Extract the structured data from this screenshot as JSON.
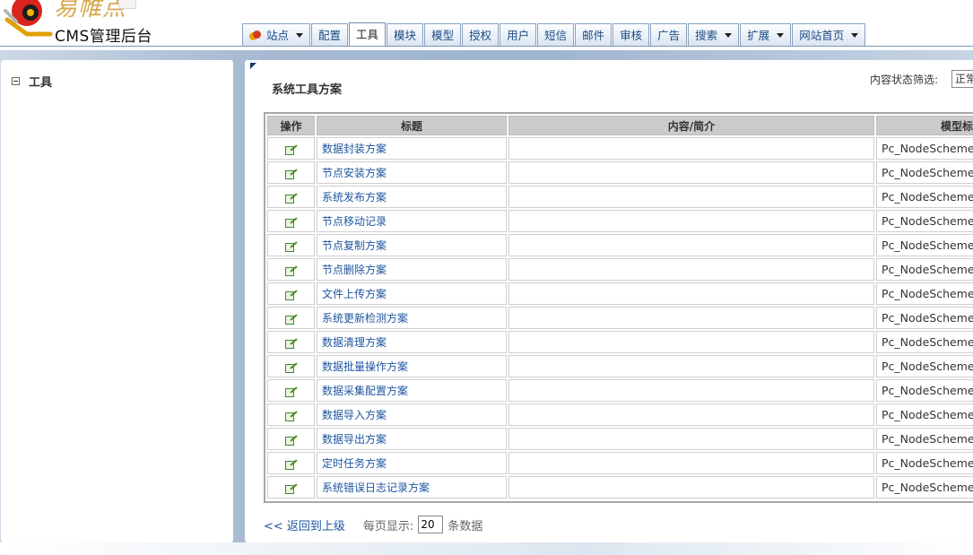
{
  "header": {
    "brand_top": "易帷点",
    "brand": "CMS管理后台"
  },
  "nav": {
    "items": [
      {
        "label": "站点",
        "dropdown": true,
        "icon": "site-icon"
      },
      {
        "label": "配置",
        "dropdown": false
      },
      {
        "label": "工具",
        "dropdown": false,
        "active": true
      },
      {
        "label": "模块",
        "dropdown": false
      },
      {
        "label": "模型",
        "dropdown": false
      },
      {
        "label": "授权",
        "dropdown": false
      },
      {
        "label": "用户",
        "dropdown": false
      },
      {
        "label": "短信",
        "dropdown": false
      },
      {
        "label": "邮件",
        "dropdown": false
      },
      {
        "label": "审核",
        "dropdown": false
      },
      {
        "label": "广告",
        "dropdown": false
      },
      {
        "label": "搜索",
        "dropdown": true
      },
      {
        "label": "扩展",
        "dropdown": true
      },
      {
        "label": "网站首页",
        "dropdown": true
      }
    ]
  },
  "sidebar": {
    "root_label": "工具"
  },
  "main": {
    "title": "系统工具方案",
    "filter_label": "内容状态筛选:",
    "filter_value": "正常",
    "columns": [
      "操作",
      "标题",
      "内容/简介",
      "模型标"
    ],
    "rows": [
      {
        "title": "数据封装方案",
        "summary": "",
        "model": "Pc_NodeScheme"
      },
      {
        "title": "节点安装方案",
        "summary": "",
        "model": "Pc_NodeScheme"
      },
      {
        "title": "系统发布方案",
        "summary": "",
        "model": "Pc_NodeScheme"
      },
      {
        "title": "节点移动记录",
        "summary": "",
        "model": "Pc_NodeScheme"
      },
      {
        "title": "节点复制方案",
        "summary": "",
        "model": "Pc_NodeScheme"
      },
      {
        "title": "节点删除方案",
        "summary": "",
        "model": "Pc_NodeScheme"
      },
      {
        "title": "文件上传方案",
        "summary": "",
        "model": "Pc_NodeScheme"
      },
      {
        "title": "系统更新检测方案",
        "summary": "",
        "model": "Pc_NodeScheme"
      },
      {
        "title": "数据清理方案",
        "summary": "",
        "model": "Pc_NodeScheme"
      },
      {
        "title": "数据批量操作方案",
        "summary": "",
        "model": "Pc_NodeScheme"
      },
      {
        "title": "数据采集配置方案",
        "summary": "",
        "model": "Pc_NodeScheme"
      },
      {
        "title": "数据导入方案",
        "summary": "",
        "model": "Pc_NodeScheme"
      },
      {
        "title": "数据导出方案",
        "summary": "",
        "model": "Pc_NodeScheme"
      },
      {
        "title": "定时任务方案",
        "summary": "",
        "model": "Pc_NodeScheme"
      },
      {
        "title": "系统错误日志记录方案",
        "summary": "",
        "model": "Pc_NodeScheme"
      }
    ],
    "row_action_icon": "edit-icon"
  },
  "footer": {
    "back_label": "<< 返回到上级",
    "pagesize_label": "每页显示:",
    "pagesize_value": "20",
    "pagesize_unit": "条数据"
  },
  "colors": {
    "link": "#1f56a0",
    "nav_text": "#1c4b86",
    "header_cell": "#cbcbcb",
    "stage_blue": "#a8bbd3"
  }
}
